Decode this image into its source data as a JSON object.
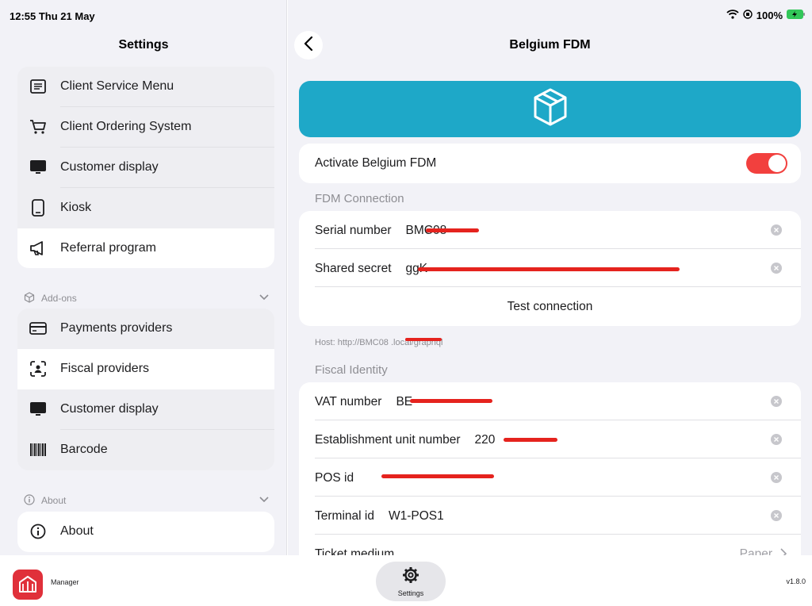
{
  "status": {
    "time": "12:55  Thu 21 May",
    "battery": "100%"
  },
  "sidebar": {
    "title": "Settings",
    "main_items": [
      {
        "label": "Client Service Menu",
        "icon": "menu-list-icon"
      },
      {
        "label": "Client Ordering System",
        "icon": "cart-icon"
      },
      {
        "label": "Customer display",
        "icon": "monitor-icon"
      },
      {
        "label": "Kiosk",
        "icon": "tablet-icon"
      },
      {
        "label": "Referral program",
        "icon": "megaphone-icon",
        "selected": true
      }
    ],
    "addons": {
      "title": "Add-ons",
      "items": [
        {
          "label": "Payments providers",
          "icon": "credit-card-icon"
        },
        {
          "label": "Fiscal providers",
          "icon": "face-scan-icon",
          "selected": true
        },
        {
          "label": "Customer display",
          "icon": "monitor-icon"
        },
        {
          "label": "Barcode",
          "icon": "barcode-icon"
        }
      ]
    },
    "about": {
      "title": "About",
      "items": [
        {
          "label": "About",
          "icon": "info-icon"
        }
      ]
    }
  },
  "detail": {
    "title": "Belgium FDM",
    "activate": {
      "label": "Activate Belgium FDM",
      "on": true
    },
    "fdm_connection": {
      "title": "FDM Connection",
      "serial_label": "Serial number",
      "serial_value": "BMC08",
      "secret_label": "Shared secret",
      "secret_value": "ggK",
      "test_label": "Test connection",
      "host": "Host: http://BMC08 .local/graphql"
    },
    "fiscal_identity": {
      "title": "Fiscal Identity",
      "rows": [
        {
          "label": "VAT number",
          "value": "BE"
        },
        {
          "label": "Establishment unit number",
          "value": "220"
        },
        {
          "label": "POS id",
          "value": ""
        },
        {
          "label": "Terminal id",
          "value": "W1-POS1"
        },
        {
          "label": "Ticket medium",
          "value": "Paper"
        }
      ]
    }
  },
  "bottom": {
    "app_name": "Manager",
    "tab_label": "Settings",
    "version": "v1.8.0"
  },
  "colors": {
    "accent_red": "#f2403e",
    "banner_teal": "#1ea8c8",
    "background": "#f2f2f7"
  }
}
